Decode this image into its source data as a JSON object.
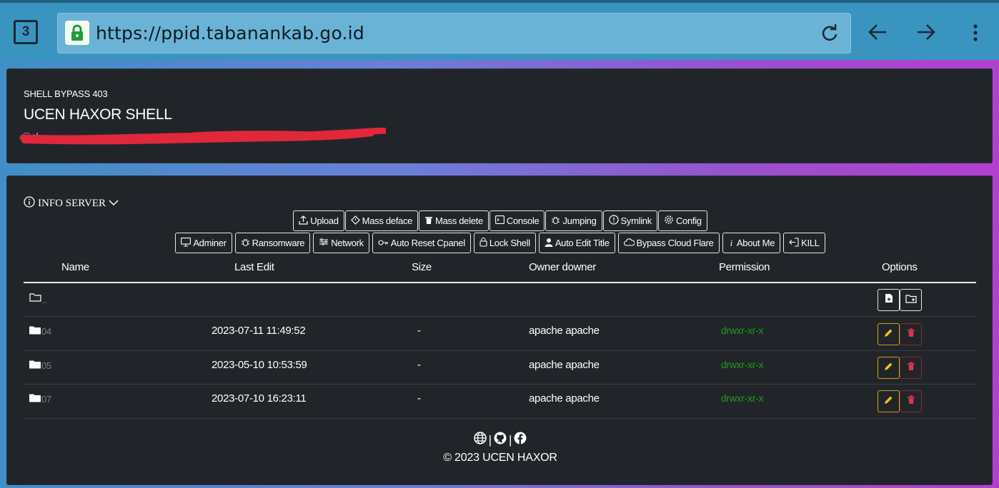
{
  "browser": {
    "tab_count": "3",
    "url": "https://ppid.tabanankab.go.id"
  },
  "header": {
    "subtitle": "SHELL BYPASS 403",
    "title": "UCEN HAXOR SHELL",
    "path": "⎕ :/"
  },
  "toolbar": {
    "info_label": "INFO SERVER",
    "row1": [
      {
        "label": "Upload",
        "icon": "upload-icon"
      },
      {
        "label": "Mass deface",
        "icon": "diamond-icon"
      },
      {
        "label": "Mass delete",
        "icon": "trash-icon"
      },
      {
        "label": "Console",
        "icon": "terminal-icon"
      },
      {
        "label": "Jumping",
        "icon": "bug-icon"
      },
      {
        "label": "Symlink",
        "icon": "exclamation-circle-icon"
      },
      {
        "label": "Config",
        "icon": "gear-icon"
      }
    ],
    "row2": [
      {
        "label": "Adminer",
        "icon": "monitor-icon"
      },
      {
        "label": "Ransomware",
        "icon": "bug-icon"
      },
      {
        "label": "Network",
        "icon": "network-icon"
      },
      {
        "label": "Auto Reset Cpanel",
        "icon": "key-icon"
      },
      {
        "label": "Lock Shell",
        "icon": "lock-icon"
      },
      {
        "label": "Auto Edit Title",
        "icon": "person-icon"
      },
      {
        "label": "Bypass Cloud Flare",
        "icon": "cloud-icon"
      },
      {
        "label": "About Me",
        "icon": "info-icon"
      },
      {
        "label": "KILL",
        "icon": "exit-icon"
      }
    ]
  },
  "table": {
    "columns": [
      "Name",
      "Last Edit",
      "Size",
      "Owner downer",
      "Permission",
      "Options"
    ],
    "parent": "..",
    "rows": [
      {
        "name": "04",
        "last_edit": "2023-07-11 11:49:52",
        "size": "-",
        "owner": "apache apache",
        "perm": "drwxr-xr-x"
      },
      {
        "name": "05",
        "last_edit": "2023-05-10 10:53:59",
        "size": "-",
        "owner": "apache apache",
        "perm": "drwxr-xr-x"
      },
      {
        "name": "07",
        "last_edit": "2023-07-10 16:23:11",
        "size": "-",
        "owner": "apache apache",
        "perm": "drwxr-xr-x"
      }
    ]
  },
  "footer": {
    "sep1": "|",
    "sep2": "|",
    "copyright": "© 2023 UCEN HAXOR"
  },
  "colors": {
    "panel_bg": "#212529",
    "permission_green": "#1e9c1e",
    "edit_yellow": "#f0c020",
    "delete_red": "#dc3545"
  }
}
